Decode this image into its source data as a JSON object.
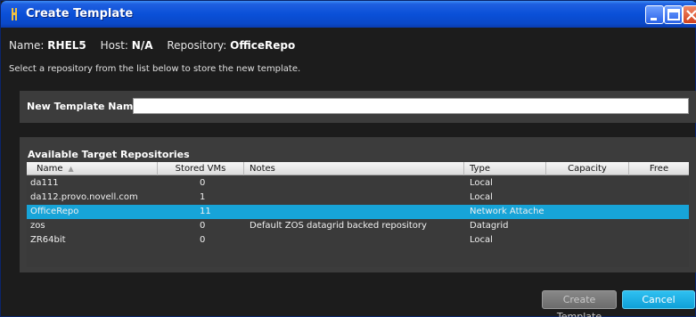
{
  "window": {
    "title": "Create Template"
  },
  "info": {
    "name_label": "Name:",
    "name_value": "RHEL5",
    "host_label": "Host:",
    "host_value": "N/A",
    "repo_label": "Repository:",
    "repo_value": "OfficeRepo"
  },
  "instructions": "Select a repository from the list below to store the new template.",
  "template_name": {
    "label": "New Template Name:",
    "value": "",
    "placeholder": ""
  },
  "repositories": {
    "title": "Available Target Repositories",
    "columns": [
      "Name",
      "Stored VMs",
      "Notes",
      "Type",
      "Capacity",
      "Free"
    ],
    "rows": [
      {
        "name": "da111",
        "stored_vms": "0",
        "notes": "",
        "type": "Local",
        "capacity": "",
        "free": "",
        "selected": false
      },
      {
        "name": "da112.provo.novell.com",
        "stored_vms": "1",
        "notes": "",
        "type": "Local",
        "capacity": "",
        "free": "",
        "selected": false
      },
      {
        "name": "OfficeRepo",
        "stored_vms": "11",
        "notes": "",
        "type": "Network Attache",
        "capacity": "",
        "free": "",
        "selected": true
      },
      {
        "name": "zos",
        "stored_vms": "0",
        "notes": "Default ZOS datagrid backed repository",
        "type": "Datagrid",
        "capacity": "",
        "free": "",
        "selected": false
      },
      {
        "name": "ZR64bit",
        "stored_vms": "0",
        "notes": "",
        "type": "Local",
        "capacity": "",
        "free": "",
        "selected": false
      }
    ]
  },
  "buttons": {
    "create": "Create Template",
    "cancel": "Cancel"
  },
  "colors": {
    "selected_row": "#17a4d8",
    "cancel_button": "#1aa8e0",
    "titlebar": "#0a50d8"
  }
}
